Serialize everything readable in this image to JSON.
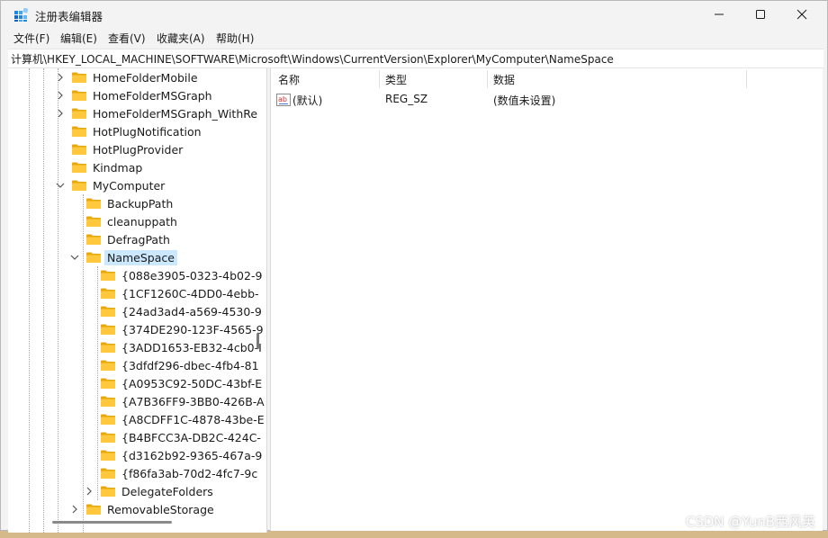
{
  "window": {
    "title": "注册表编辑器"
  },
  "menu": [
    "文件(F)",
    "编辑(E)",
    "查看(V)",
    "收藏夹(A)",
    "帮助(H)"
  ],
  "address": "计算机\\HKEY_LOCAL_MACHINE\\SOFTWARE\\Microsoft\\Windows\\CurrentVersion\\Explorer\\MyComputer\\NameSpace",
  "tree": [
    {
      "label": "HomeFolderMobile",
      "level": 0,
      "expander": "collapsed"
    },
    {
      "label": "HomeFolderMSGraph",
      "level": 0,
      "expander": "collapsed"
    },
    {
      "label": "HomeFolderMSGraph_WithRe",
      "level": 0,
      "expander": "collapsed"
    },
    {
      "label": "HotPlugNotification",
      "level": 0,
      "expander": "none"
    },
    {
      "label": "HotPlugProvider",
      "level": 0,
      "expander": "none"
    },
    {
      "label": "Kindmap",
      "level": 0,
      "expander": "none"
    },
    {
      "label": "MyComputer",
      "level": 0,
      "expander": "expanded"
    },
    {
      "label": "BackupPath",
      "level": 1,
      "expander": "none"
    },
    {
      "label": "cleanuppath",
      "level": 1,
      "expander": "none"
    },
    {
      "label": "DefragPath",
      "level": 1,
      "expander": "none"
    },
    {
      "label": "NameSpace",
      "level": 1,
      "expander": "expanded",
      "selected": true
    },
    {
      "label": "{088e3905-0323-4b02-9",
      "level": 2,
      "expander": "none"
    },
    {
      "label": "{1CF1260C-4DD0-4ebb-",
      "level": 2,
      "expander": "none"
    },
    {
      "label": "{24ad3ad4-a569-4530-9",
      "level": 2,
      "expander": "none"
    },
    {
      "label": "{374DE290-123F-4565-9",
      "level": 2,
      "expander": "none"
    },
    {
      "label": "{3ADD1653-EB32-4cb0-I",
      "level": 2,
      "expander": "none"
    },
    {
      "label": "{3dfdf296-dbec-4fb4-81",
      "level": 2,
      "expander": "none"
    },
    {
      "label": "{A0953C92-50DC-43bf-E",
      "level": 2,
      "expander": "none"
    },
    {
      "label": "{A7B36FF9-3BB0-426B-A",
      "level": 2,
      "expander": "none"
    },
    {
      "label": "{A8CDFF1C-4878-43be-E",
      "level": 2,
      "expander": "none"
    },
    {
      "label": "{B4BFCC3A-DB2C-424C-",
      "level": 2,
      "expander": "none"
    },
    {
      "label": "{d3162b92-9365-467a-9",
      "level": 2,
      "expander": "none"
    },
    {
      "label": "{f86fa3ab-70d2-4fc7-9c",
      "level": 2,
      "expander": "none"
    },
    {
      "label": "DelegateFolders",
      "level": 2,
      "expander": "collapsed"
    },
    {
      "label": "RemovableStorage",
      "level": 1,
      "expander": "collapsed"
    }
  ],
  "columns": {
    "name": "名称",
    "type": "类型",
    "data": "数据"
  },
  "values": [
    {
      "name": "(默认)",
      "type": "REG_SZ",
      "data": "(数值未设置)"
    }
  ],
  "watermark": "CSDN @YunB西风英",
  "colors": {
    "folder": "#ffc83d",
    "selection": "#cce8ff",
    "accent": "#0078d4"
  }
}
